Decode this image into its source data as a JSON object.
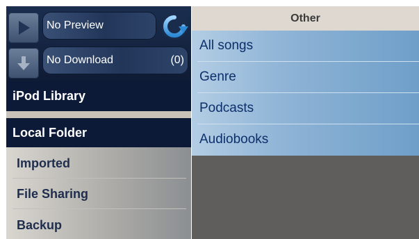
{
  "sidebar": {
    "preview": {
      "label": "No Preview"
    },
    "download": {
      "label": "No Download",
      "count": "(0)"
    },
    "sections": [
      {
        "label": "iPod Library"
      },
      {
        "label": "Local Folder"
      }
    ],
    "items": [
      {
        "label": "Imported"
      },
      {
        "label": "File Sharing"
      },
      {
        "label": "Backup"
      }
    ]
  },
  "panel": {
    "title": "Other",
    "rows": [
      {
        "label": "All songs"
      },
      {
        "label": "Genre"
      },
      {
        "label": "Podcasts"
      },
      {
        "label": "Audiobooks"
      }
    ]
  },
  "icons": {
    "play": "play-icon",
    "download": "download-arrow-icon",
    "refresh": "refresh-icon"
  },
  "colors": {
    "sidebar_dark": "#0c1a38",
    "list_blue": "#8fb4d6",
    "panel_gray": "#5f5e5c",
    "text_blue": "#0d2f6a"
  }
}
